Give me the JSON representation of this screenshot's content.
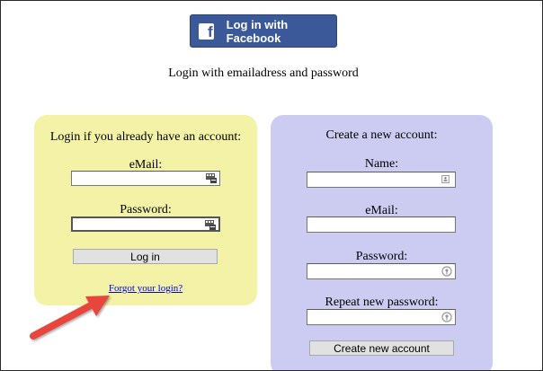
{
  "facebook": {
    "button_label": "Log in with Facebook",
    "logo_letter": "f",
    "color": "#3b5998"
  },
  "subtitle": "Login with emailadress and password",
  "login_panel": {
    "heading": "Login if you already have an account:",
    "email_label": "eMail:",
    "email_value": "",
    "password_label": "Password:",
    "password_value": "",
    "login_button": "Log in",
    "forgot_link": "Forgot your login?",
    "background": "#f3f2a6"
  },
  "register_panel": {
    "heading": "Create a new account:",
    "name_label": "Name:",
    "name_value": "",
    "email_label": "eMail:",
    "email_value": "",
    "password_label": "Password:",
    "password_value": "",
    "repeat_password_label": "Repeat new password:",
    "repeat_password_value": "",
    "create_button": "Create new account",
    "background": "#ccccf3"
  },
  "annotation": {
    "arrow_color": "#e8453c",
    "arrow_icon": "red-arrow-icon"
  }
}
